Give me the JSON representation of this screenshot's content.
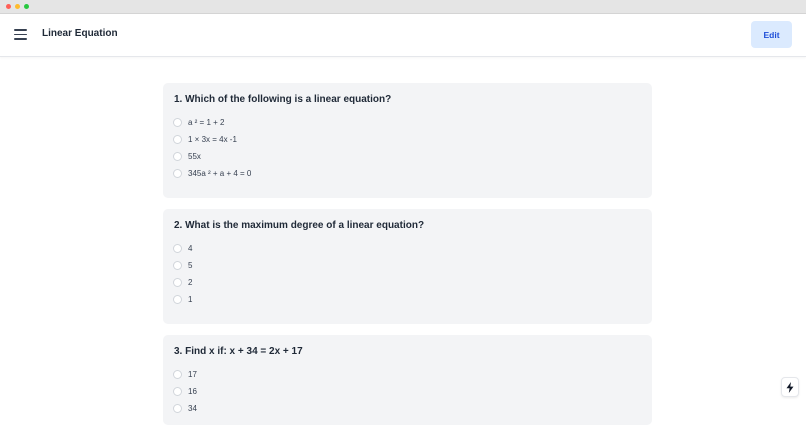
{
  "app": {
    "title": "Linear Equation",
    "edit_label": "Edit",
    "colors": {
      "accent_bg": "#dbeafe",
      "accent_text": "#1d4ed8",
      "card_bg": "#f3f4f6"
    }
  },
  "icons": {
    "menu": "hamburger-icon",
    "fab": "lightning-bolt-icon"
  },
  "questions": [
    {
      "text": "1. Which of the following is a linear equation?",
      "options": [
        "a ² = 1 + 2",
        "1 × 3x = 4x -1",
        "55x",
        "345a ² + a + 4 = 0"
      ]
    },
    {
      "text": "2. What is the maximum degree of a linear equation?",
      "options": [
        "4",
        "5",
        "2",
        "1"
      ]
    },
    {
      "text": "3. Find x if: x + 34 = 2x + 17",
      "options": [
        "17",
        "16",
        "34"
      ]
    }
  ]
}
